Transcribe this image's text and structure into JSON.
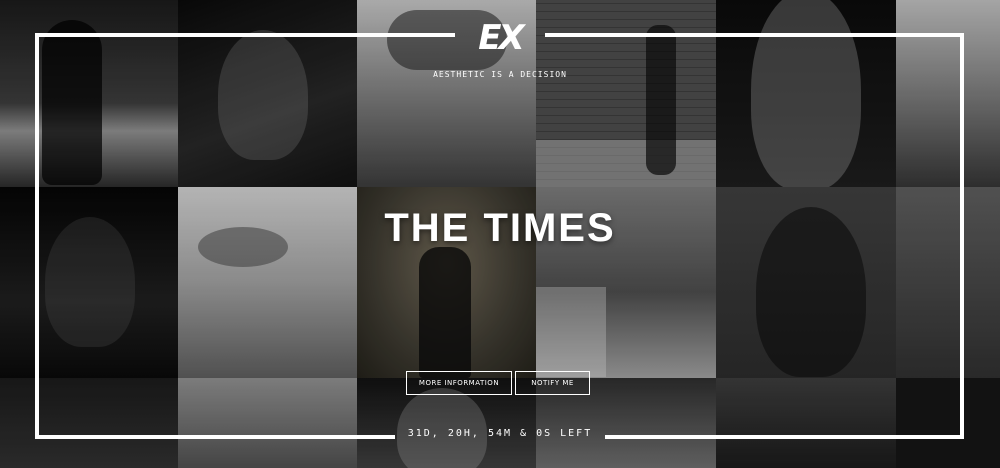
{
  "brand": {
    "logo_text": "EX",
    "tagline": "AESTHETIC IS A DECISION"
  },
  "main": {
    "title": "THE TIMES"
  },
  "buttons": {
    "more_info": "MORE INFORMATION",
    "notify": "NOTIFY ME"
  },
  "countdown": {
    "text": "31D, 20H, 54M & 0S LEFT"
  },
  "colors": {
    "accent": "#ffffff",
    "background": "#0d0d0d"
  }
}
